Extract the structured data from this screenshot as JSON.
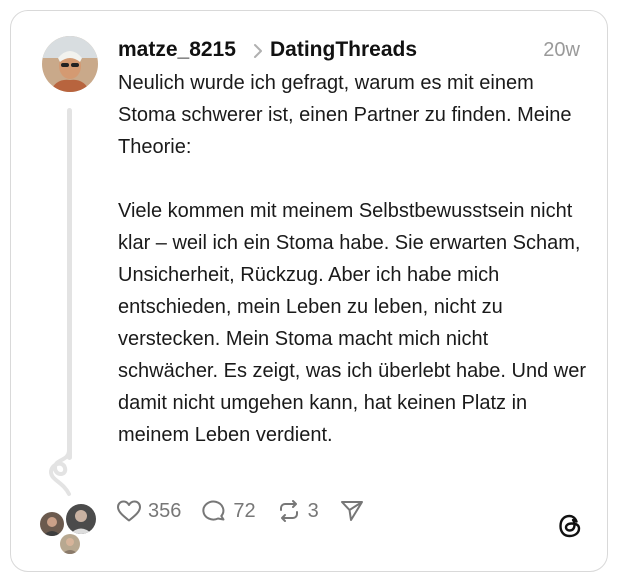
{
  "post": {
    "username": "matze_8215",
    "community": "DatingThreads",
    "time": "20w",
    "paragraph_1": "Neulich wurde ich gefragt, warum es mit einem Stoma schwerer ist, einen Partner zu finden. Meine Theorie:",
    "paragraph_2": "Viele kommen mit meinem Selbstbewusstsein nicht klar – weil ich ein Stoma habe. Sie erwarten Scham, Unsicherheit, Rückzug. Aber ich habe mich entschieden, mein Leben zu leben, nicht zu verstecken. Mein Stoma macht mich nicht schwächer. Es zeigt, was ich überlebt habe. Und wer damit nicht umgehen kann, hat keinen Platz in meinem Leben verdient."
  },
  "actions": {
    "likes": "356",
    "replies": "72",
    "reposts": "3"
  },
  "icons": {
    "like": "heart-icon",
    "reply": "comment-bubble-icon",
    "repost": "repost-icon",
    "share": "send-icon",
    "brand": "threads-logo-icon"
  },
  "colors": {
    "text": "#1a1a1a",
    "muted": "#9a9a9a",
    "border": "#d9d9d9",
    "thread_line": "#e3e3e3"
  }
}
